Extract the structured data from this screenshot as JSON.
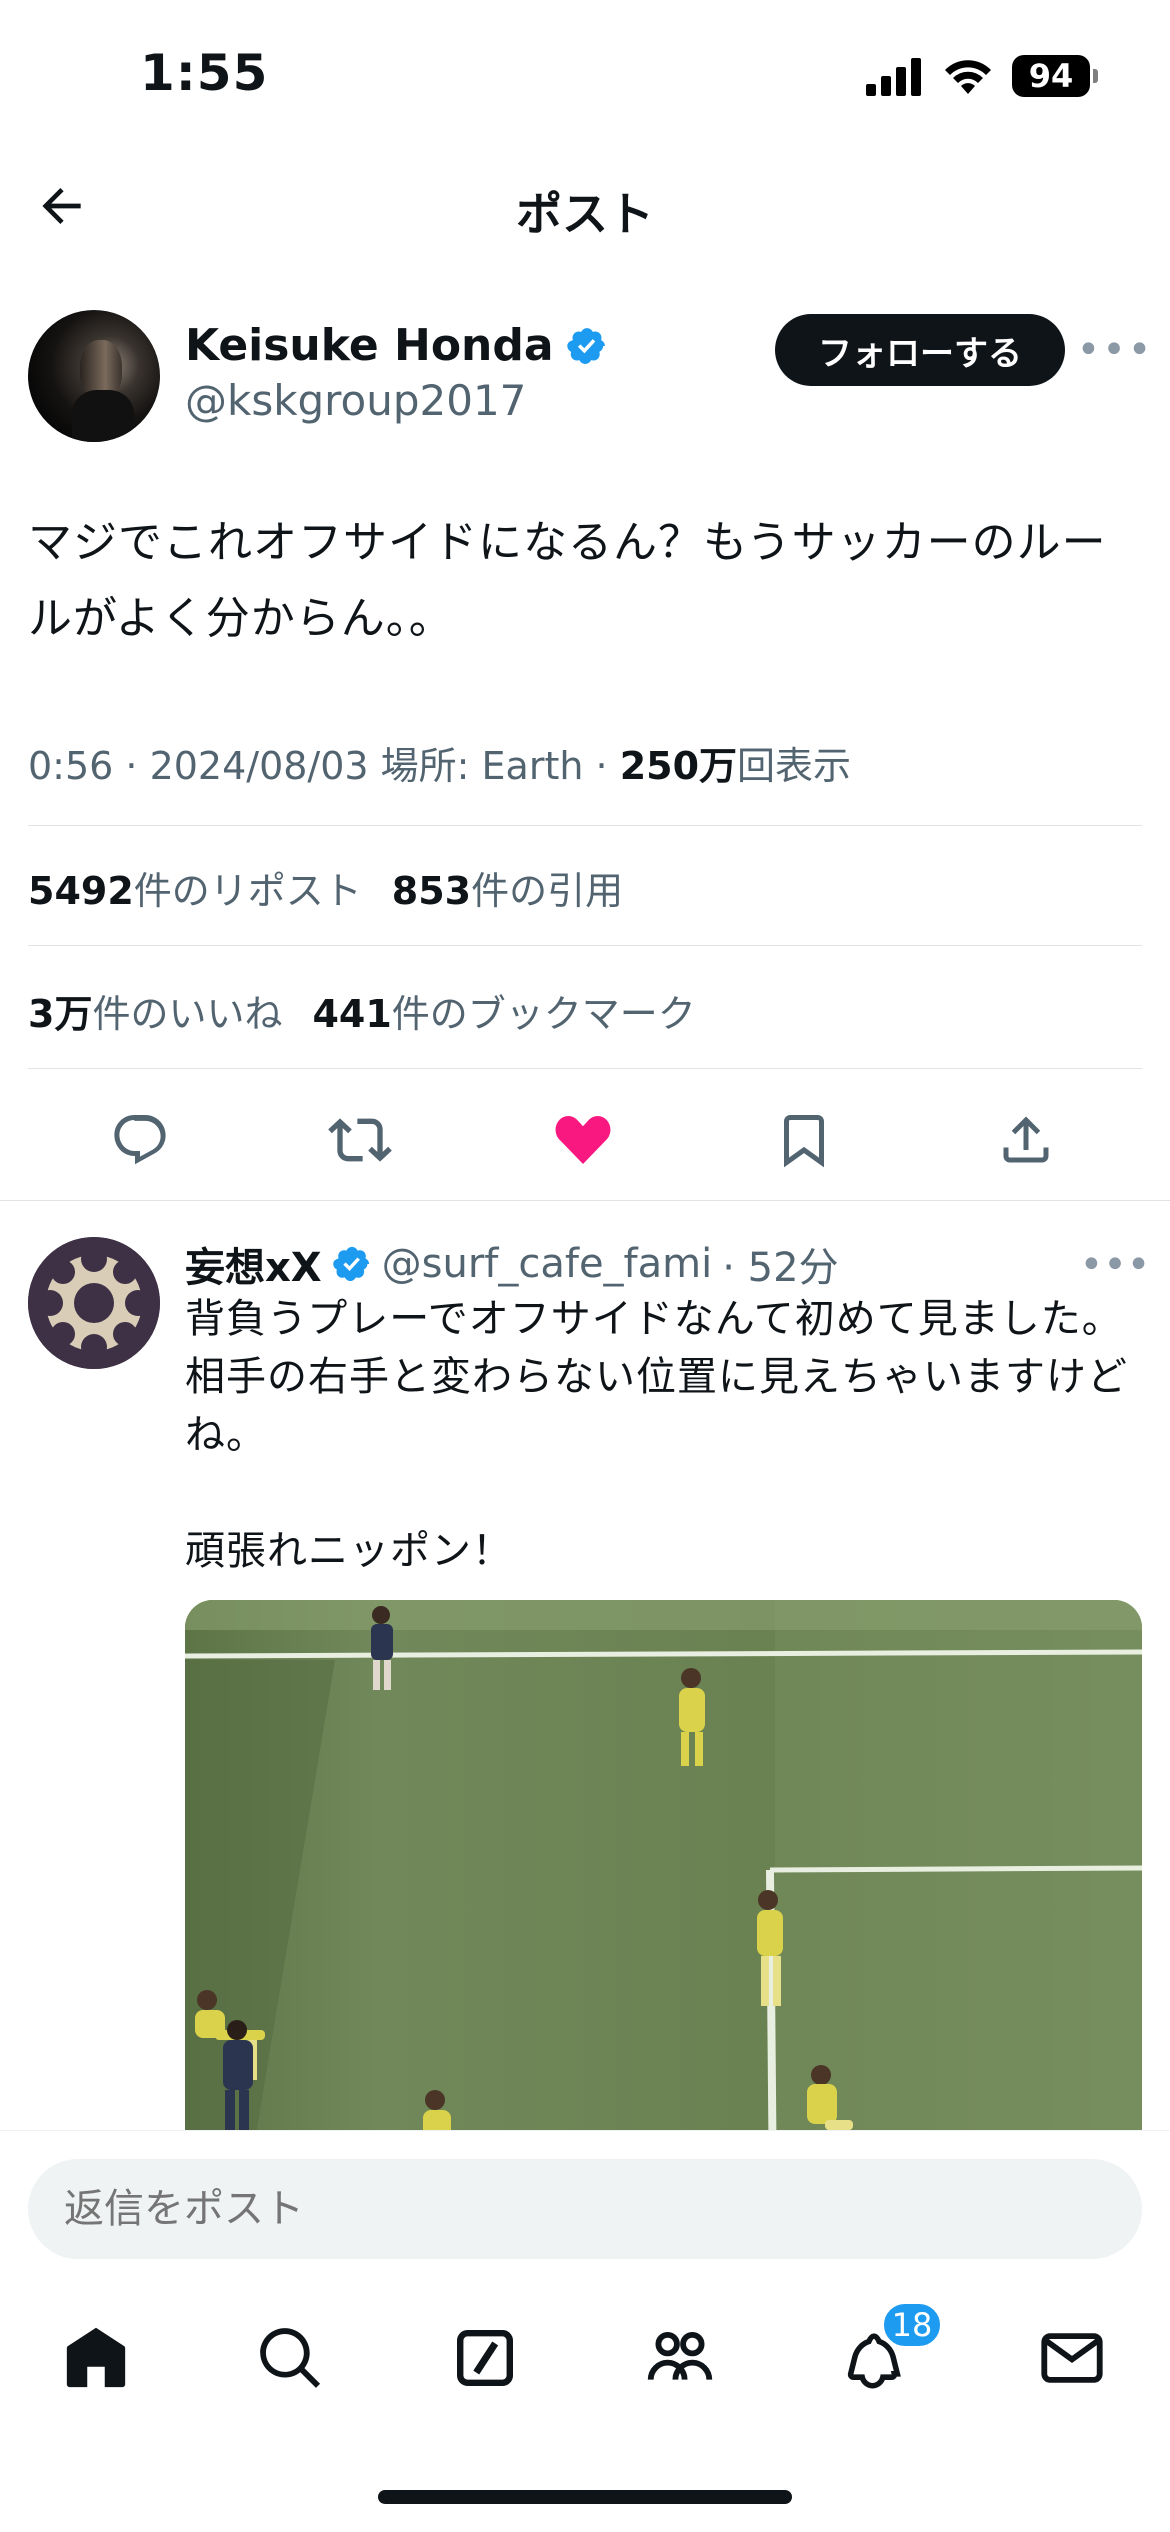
{
  "status_bar": {
    "time": "1:55",
    "battery": "94"
  },
  "header": {
    "title": "ポスト"
  },
  "post": {
    "author_name": "Keisuke Honda",
    "author_handle": "@kskgroup2017",
    "follow_label": "フォローする",
    "more_label": "•••",
    "text": "マジでこれオフサイドになるん？もうサッカーのルールがよく分からん。。",
    "meta_prefix": "0:56 · 2024/08/03 場所: Earth · ",
    "views_count": "250万",
    "views_label": "回表示",
    "reposts_count": "5492",
    "reposts_label": "件のリポスト",
    "quotes_count": "853",
    "quotes_label": "件の引用",
    "likes_count": "3万",
    "likes_label": "件のいいね",
    "bookmarks_count": "441",
    "bookmarks_label": "件のブックマーク"
  },
  "reply": {
    "name": "妄想xX",
    "handle": "@surf_cafe_fami",
    "time": "· 52分",
    "more_label": "•••",
    "text": "背負うプレーでオフサイドなんて初めて見ました。相手の右手と変わらない位置に見えちゃいますけどね。\n\n頑張れニッポン！"
  },
  "composer": {
    "placeholder": "返信をポスト"
  },
  "tab_bar": {
    "notifications_badge": "18"
  },
  "colors": {
    "accent": "#1d9bf0",
    "like": "#f91880",
    "text_primary": "#0f1419",
    "text_secondary": "#536471"
  },
  "icons": [
    "back-arrow-icon",
    "verified-icon",
    "reply-icon",
    "repost-icon",
    "like-icon",
    "bookmark-icon",
    "share-icon",
    "home-icon",
    "search-icon",
    "compose-icon",
    "communities-icon",
    "notifications-icon",
    "messages-icon"
  ]
}
